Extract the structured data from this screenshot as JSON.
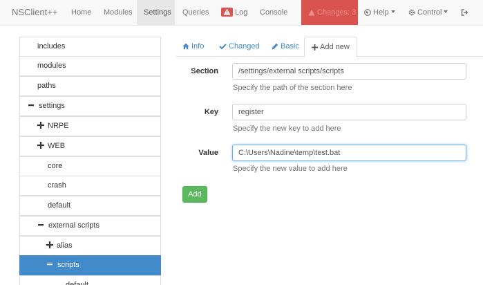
{
  "navbar": {
    "brand": "NSClient++",
    "items": [
      {
        "label": "Home"
      },
      {
        "label": "Modules"
      },
      {
        "label": "Settings"
      },
      {
        "label": "Queries"
      },
      {
        "label": "Log"
      },
      {
        "label": "Console"
      },
      {
        "label": "Changes: 3"
      },
      {
        "label": "Help"
      },
      {
        "label": "Control"
      }
    ]
  },
  "tree": {
    "items": [
      {
        "label": "includes"
      },
      {
        "label": "modules"
      },
      {
        "label": "paths"
      },
      {
        "label": "settings",
        "icon": "minus-icon"
      },
      {
        "label": "NRPE",
        "icon": "plus-icon"
      },
      {
        "label": "WEB",
        "icon": "plus-icon"
      },
      {
        "label": "core"
      },
      {
        "label": "crash"
      },
      {
        "label": "default"
      },
      {
        "label": "external scripts",
        "icon": "minus-icon"
      },
      {
        "label": "alias",
        "icon": "plus-icon"
      },
      {
        "label": "scripts",
        "icon": "minus-icon",
        "selected": true
      },
      {
        "label": "default"
      }
    ]
  },
  "tabs": [
    {
      "label": "Info",
      "icon": "home-icon"
    },
    {
      "label": "Changed",
      "icon": "check-icon"
    },
    {
      "label": "Basic",
      "icon": "pencil-icon"
    },
    {
      "label": "Add new",
      "icon": "plus-icon",
      "active": true
    }
  ],
  "form": {
    "section": {
      "label": "Section",
      "value": "/settings/external scripts/scripts",
      "help": "Specify the path of the section here"
    },
    "key": {
      "label": "Key",
      "value": "register",
      "help": "Specify the new key to add here"
    },
    "value": {
      "label": "Value",
      "value": "C:\\Users\\Nadine\\temp\\test.bat",
      "help": "Specify the new value to add here"
    },
    "add_button": "Add"
  },
  "colors": {
    "accent": "#428bca",
    "danger": "#d9534f",
    "success": "#5cb85c"
  }
}
